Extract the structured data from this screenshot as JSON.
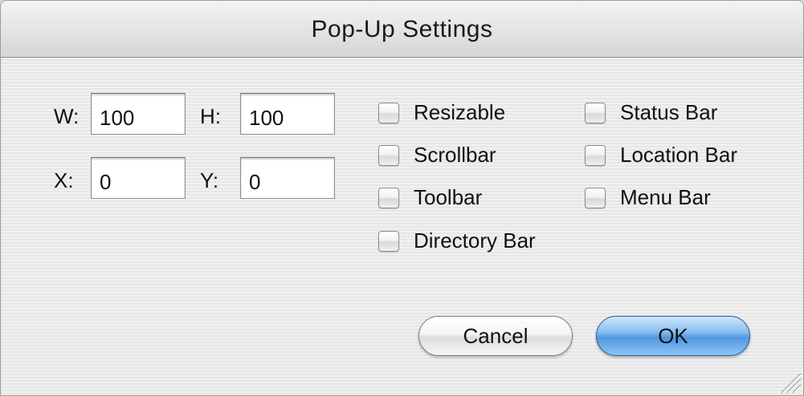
{
  "window": {
    "title": "Pop-Up Settings"
  },
  "size": {
    "width_label": "W:",
    "width_value": "100",
    "height_label": "H:",
    "height_value": "100"
  },
  "position": {
    "x_label": "X:",
    "x_value": "0",
    "y_label": "Y:",
    "y_value": "0"
  },
  "options_left": [
    {
      "label": "Resizable",
      "checked": false
    },
    {
      "label": "Scrollbar",
      "checked": false
    },
    {
      "label": "Toolbar",
      "checked": false
    },
    {
      "label": "Directory Bar",
      "checked": false
    }
  ],
  "options_right": [
    {
      "label": "Status Bar",
      "checked": false
    },
    {
      "label": "Location Bar",
      "checked": false
    },
    {
      "label": "Menu Bar",
      "checked": false
    }
  ],
  "buttons": {
    "cancel_label": "Cancel",
    "ok_label": "OK"
  },
  "icons": {
    "resize_grip": "resize-grip-icon"
  }
}
